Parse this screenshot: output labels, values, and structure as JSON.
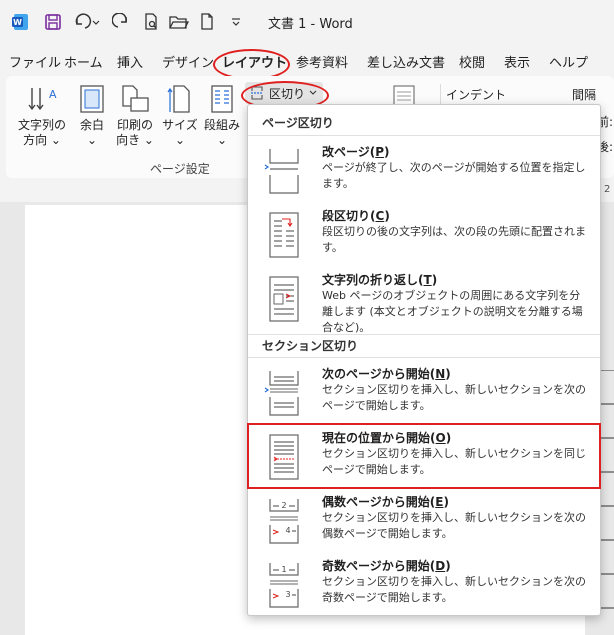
{
  "titlebar": {
    "doc_title": "文書 1  -  Word",
    "word_icon": "word-icon",
    "save_icon": "save-icon",
    "undo_icon": "undo-icon",
    "redo_icon": "redo-icon",
    "print_icon": "print-preview-icon",
    "open_icon": "open-folder-icon",
    "new_icon": "new-document-icon",
    "customize_icon": "chevron-down-icon"
  },
  "tabs": [
    "ファイル",
    "ホーム",
    "挿入",
    "デザイン",
    "レイアウト",
    "参考資料",
    "差し込み文書",
    "校閲",
    "表示",
    "ヘルプ"
  ],
  "ribbon": {
    "text_direction": "文字列の\n方向 ⌄",
    "margins": "余白\n⌄",
    "orientation": "印刷の\n向き ⌄",
    "size": "サイズ\n⌄",
    "columns": "段組み\n⌄",
    "group_label": "ページ設定",
    "breaks_label": "区切り",
    "indent_label": "インデント",
    "spacing_label": "間隔",
    "before_label": "前:",
    "after_label": "後:"
  },
  "colors": {
    "accent_red": "#e02020",
    "word_blue": "#185abd",
    "save_purple": "#7a2d9e"
  },
  "menu": {
    "page_breaks_header": "ページ区切り",
    "section_breaks_header": "セクション区切り",
    "page_items": [
      {
        "title": "改ページ",
        "key": "P",
        "desc": "ページが終了し、次のページが開始する位置を指定します。"
      },
      {
        "title": "段区切り",
        "key": "C",
        "desc": "段区切りの後の文字列は、次の段の先頭に配置されます。"
      },
      {
        "title": "文字列の折り返し",
        "key": "T",
        "desc": "Web ページのオブジェクトの周囲にある文字列を分離します (本文とオブジェクトの説明文を分離する場合など)。"
      }
    ],
    "section_items": [
      {
        "title": "次のページから開始",
        "key": "N",
        "desc": "セクション区切りを挿入し、新しいセクションを次のページで開始します。"
      },
      {
        "title": "現在の位置から開始",
        "key": "O",
        "desc": "セクション区切りを挿入し、新しいセクションを同じページで開始します。"
      },
      {
        "title": "偶数ページから開始",
        "key": "E",
        "desc": "セクション区切りを挿入し、新しいセクションを次の偶数ページで開始します。"
      },
      {
        "title": "奇数ページから開始",
        "key": "D",
        "desc": "セクション区切りを挿入し、新しいセクションを次の奇数ページで開始します。"
      }
    ],
    "even_icon_num1": "2",
    "even_icon_num2": "4",
    "odd_icon_num1": "1",
    "odd_icon_num2": "3"
  },
  "ruler_mark": "2"
}
